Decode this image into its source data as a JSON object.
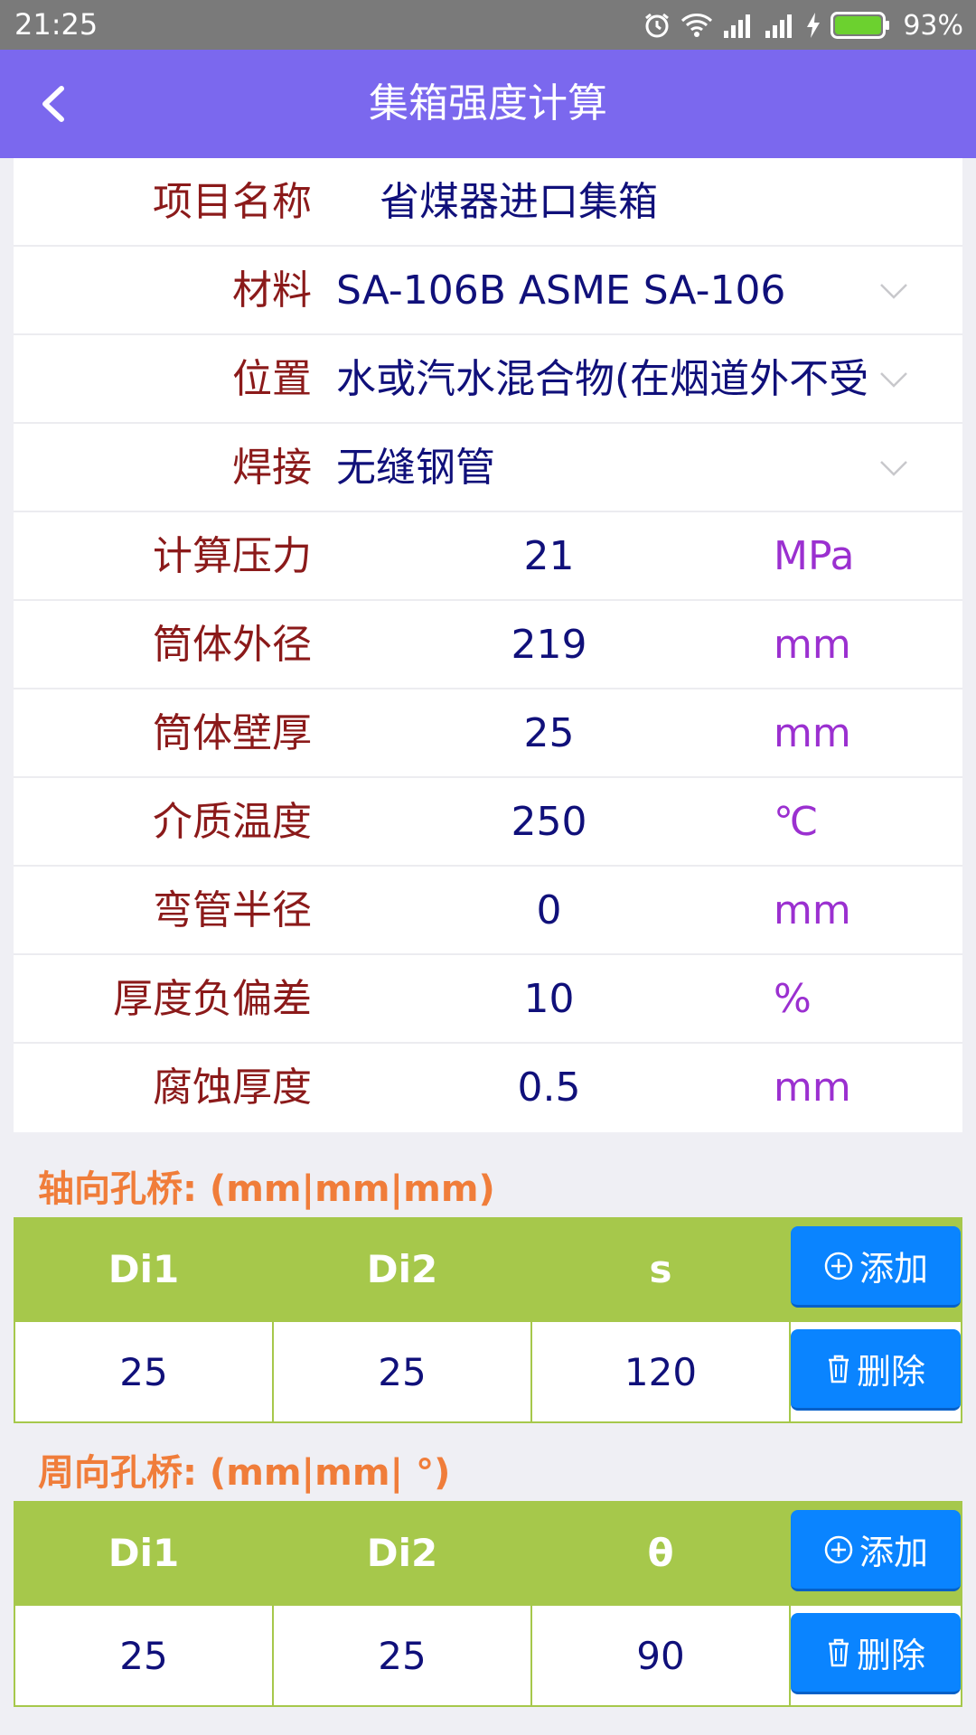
{
  "status_bar": {
    "time": "21:25",
    "battery": "93%",
    "icons": [
      "alarm-icon",
      "wifi-icon",
      "signal-icon",
      "signal-icon",
      "charging-icon",
      "battery-icon"
    ]
  },
  "app_bar": {
    "title": "集箱强度计算",
    "back_icon": "chevron-left-icon"
  },
  "form": {
    "project_name": {
      "label": "项目名称",
      "value": "省煤器进口集箱"
    },
    "material": {
      "label": "材料",
      "value": "SA-106B ASME SA-106"
    },
    "position": {
      "label": "位置",
      "value": "水或汽水混合物(在烟道外不受"
    },
    "welding": {
      "label": "焊接",
      "value": "无缝钢管"
    },
    "pressure": {
      "label": "计算压力",
      "value": "21",
      "unit": "MPa"
    },
    "outer_diameter": {
      "label": "筒体外径",
      "value": "219",
      "unit": "mm"
    },
    "wall_thickness": {
      "label": "筒体壁厚",
      "value": "25",
      "unit": "mm"
    },
    "medium_temp": {
      "label": "介质温度",
      "value": "250",
      "unit": "℃"
    },
    "bend_radius": {
      "label": "弯管半径",
      "value": "0",
      "unit": "mm"
    },
    "thickness_tolerance": {
      "label": "厚度负偏差",
      "value": "10",
      "unit": "%"
    },
    "corrosion_thickness": {
      "label": "腐蚀厚度",
      "value": "0.5",
      "unit": "mm"
    }
  },
  "axial_bridge": {
    "title": "轴向孔桥: (mm|mm|mm)",
    "headers": [
      "Di1",
      "Di2",
      "s"
    ],
    "row": [
      "25",
      "25",
      "120"
    ],
    "add_label": "添加",
    "delete_label": "删除"
  },
  "circumferential_bridge": {
    "title": "周向孔桥: (mm|mm| °)",
    "headers": [
      "Di1",
      "Di2",
      "θ"
    ],
    "row": [
      "25",
      "25",
      "90"
    ],
    "add_label": "添加",
    "delete_label": "删除"
  },
  "colors": {
    "app_bar": "#7b68ee",
    "label": "#8b1a1a",
    "value": "#10107a",
    "unit": "#9b30d0",
    "section_title": "#f07d3a",
    "table_header": "#a6c84b",
    "action_button": "#0a84ff"
  }
}
